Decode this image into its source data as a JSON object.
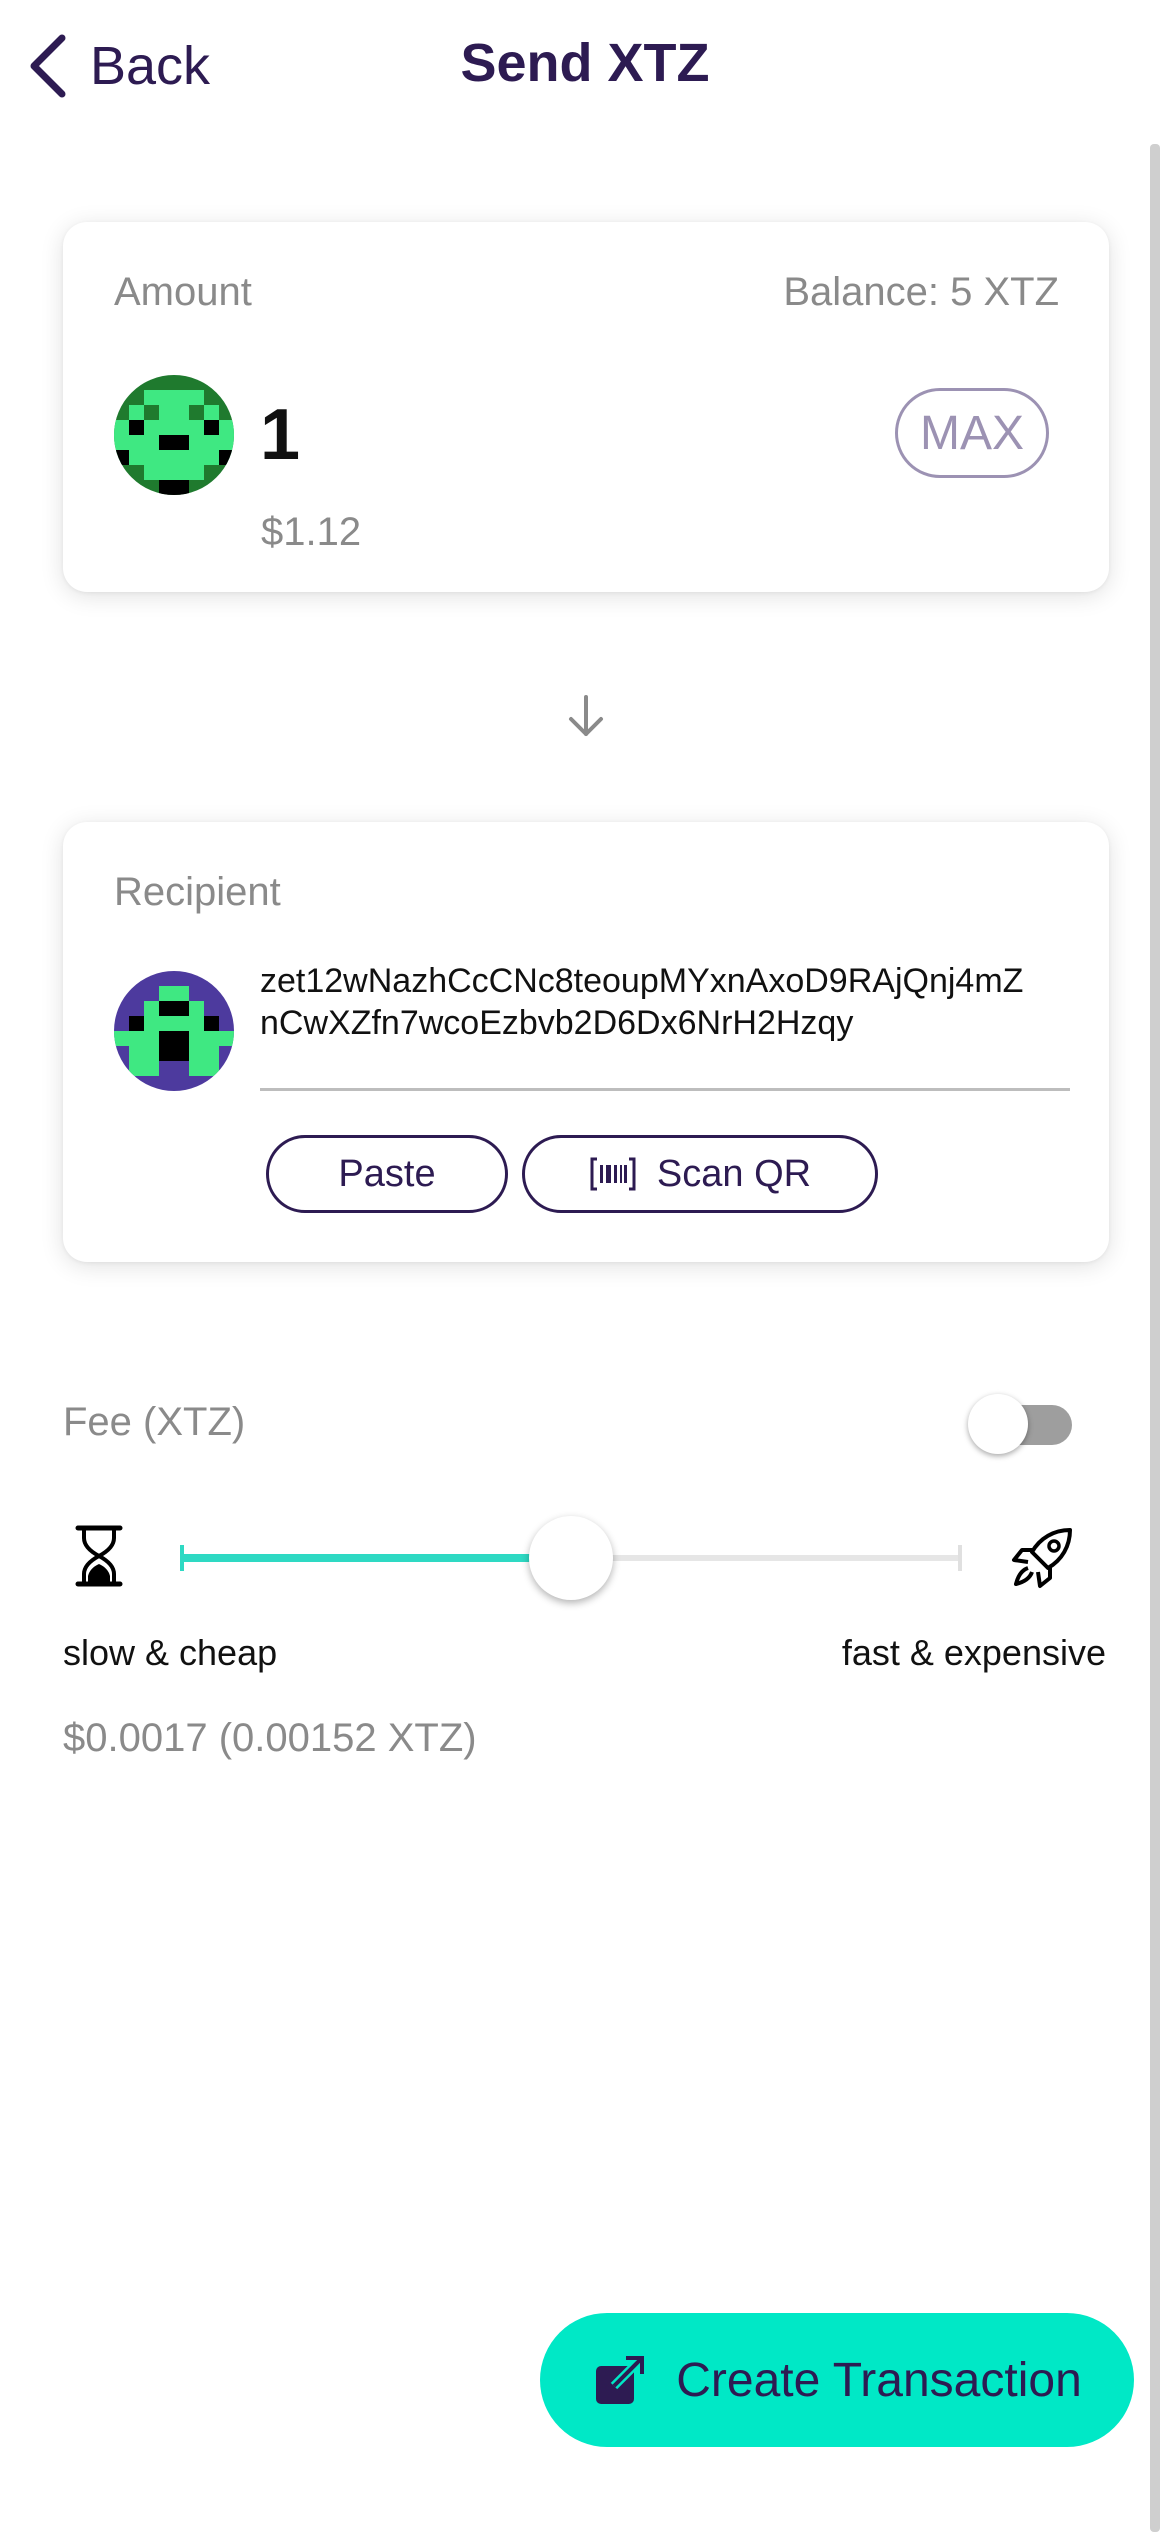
{
  "header": {
    "back_label": "Back",
    "title": "Send XTZ"
  },
  "amount_card": {
    "label": "Amount",
    "balance": "Balance: 5 XTZ",
    "value": "1",
    "fiat": "$1.12",
    "max_label": "MAX",
    "avatar_colors": {
      "dark": "#1f7a2e",
      "light": "#3fe882",
      "black": "#000000"
    }
  },
  "recipient_card": {
    "label": "Recipient",
    "address": "zet12wNazhCcCNc8teoupMYxnAxoD9RAjQnj4mZnCwXZfn7wcoEzbvb2D6Dx6NrH2Hzqy",
    "paste_label": "Paste",
    "scan_label": "Scan QR",
    "avatar_colors": {
      "bg": "#4d3a9e",
      "light": "#3fe882",
      "black": "#000000"
    }
  },
  "fee": {
    "label": "Fee (XTZ)",
    "custom_fee_enabled": false,
    "slider_level": 0.5,
    "slow_label": "slow & cheap",
    "fast_label": "fast & expensive",
    "value_text": "$0.0017 (0.00152 XTZ)"
  },
  "actions": {
    "create_label": "Create Transaction"
  },
  "icons": {
    "back": "chevron-left-icon",
    "arrow": "arrow-down-icon",
    "scan": "barcode-icon",
    "slow": "hourglass-icon",
    "fast": "rocket-icon",
    "create": "external-link-icon"
  },
  "colors": {
    "brand_dark": "#2d1b52",
    "accent": "#00e8c6",
    "slider_fill": "#2ed9c3",
    "muted_text": "#8a8a8a"
  }
}
